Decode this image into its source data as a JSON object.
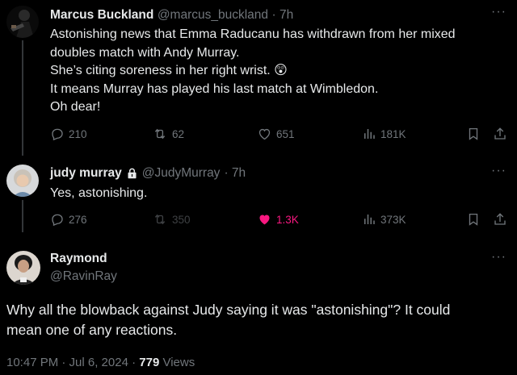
{
  "tweets": [
    {
      "name": "Marcus Buckland",
      "handle": "@marcus_buckland",
      "time": "· 7h",
      "lines": [
        "Astonishing news that Emma Raducanu has withdrawn from her mixed",
        "doubles match with Andy Murray.",
        "She’s citing soreness in her right wrist. 😲",
        "It means Murray has played his last match at Wimbledon.",
        "Oh dear!"
      ],
      "replies": "210",
      "reposts": "62",
      "likes": "651",
      "views": "181K"
    },
    {
      "name": "judy murray",
      "handle": "@JudyMurray",
      "time": "· 7h",
      "lines": [
        "Yes, astonishing."
      ],
      "replies": "276",
      "reposts": "350",
      "likes": "1.3K",
      "views": "373K"
    }
  ],
  "main": {
    "name": "Raymond",
    "handle": "@RavinRay",
    "text_lines": [
      "Why all the blowback against Judy saying it was \"astonishing\"? It could",
      "mean one of any reactions."
    ],
    "time": "10:47 PM · Jul 6, 2024 ·",
    "views_count": "779",
    "views_label": "Views"
  },
  "colors": {
    "like_active": "#f91880",
    "muted": "#71767b",
    "text": "#e7e9ea"
  },
  "icons": [
    "reply-icon",
    "repost-icon",
    "heart-icon",
    "views-icon",
    "bookmark-icon",
    "share-icon",
    "more-icon",
    "lock-icon"
  ]
}
